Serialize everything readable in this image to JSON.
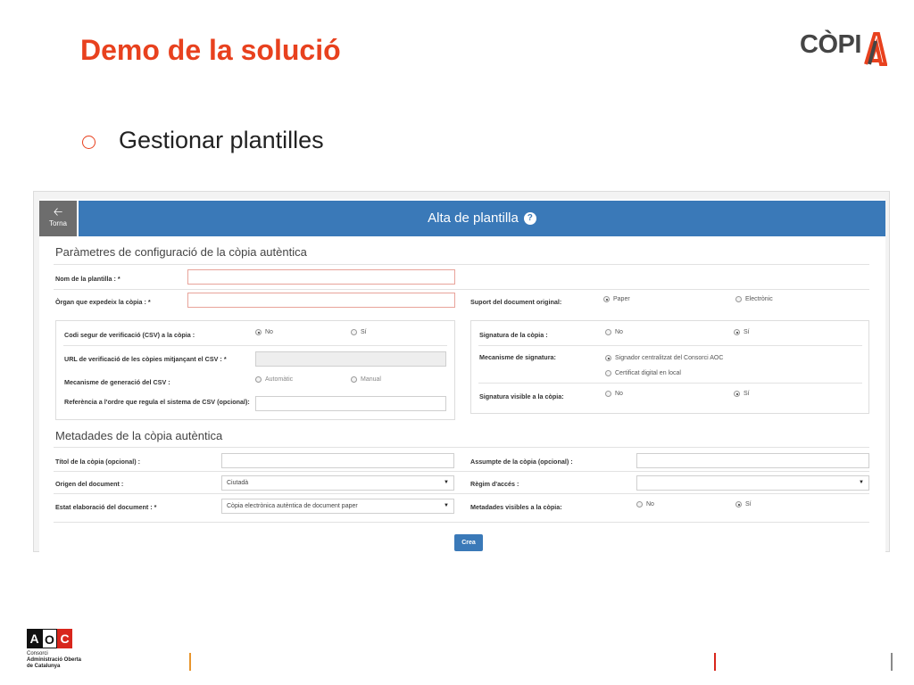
{
  "slide": {
    "title": "Demo de la solució",
    "bullet": "Gestionar plantilles",
    "logo_copia": "CÒPI",
    "aoc_logo": {
      "letters": [
        "A",
        "O",
        "C"
      ],
      "line1": "Consorci",
      "line2": "Administració Oberta",
      "line3": "de Catalunya"
    }
  },
  "app": {
    "back_label": "Torna",
    "header_title": "Alta de plantilla",
    "help_glyph": "?",
    "section1": {
      "title": "Paràmetres de configuració de la còpia autèntica",
      "nom_label": "Nom de la plantilla : *",
      "organ_label": "Òrgan que expedeix la còpia : *",
      "suport_label": "Suport del document original:",
      "suport_options": [
        "Paper",
        "Electrònic"
      ],
      "suport_selected": "Paper",
      "csv_panel": {
        "csv_label": "Codi segur de verificació (CSV) a la còpia :",
        "csv_options": [
          "No",
          "Sí"
        ],
        "url_label": "URL de verificació de les còpies mitjançant el CSV : *",
        "mecanisme_label": "Mecanisme de generació del CSV :",
        "mecanisme_options": [
          "Automàtic",
          "Manual"
        ],
        "referencia_label": "Referència a l'ordre que regula el sistema de CSV (opcional):"
      },
      "signatura_panel": {
        "signatura_label": "Signatura de la còpia :",
        "signatura_options": [
          "No",
          "Sí"
        ],
        "mecanisme_label": "Mecanisme de signatura:",
        "mecanisme_options": [
          "Signador centralitzat del Consorci AOC",
          "Certificat digital en local"
        ],
        "visible_label": "Signatura visible a la còpia:",
        "visible_options": [
          "No",
          "Sí"
        ]
      }
    },
    "section2": {
      "title": "Metadades de la còpia autèntica",
      "titol_label": "Títol de la còpia (opcional) :",
      "assumpte_label": "Assumpte de la còpia (opcional) :",
      "origen_label": "Origen del document :",
      "origen_value": "Ciutadà",
      "regim_label": "Règim d'accés :",
      "regim_value": "",
      "estat_label": "Estat elaboració del document : *",
      "estat_value": "Còpia electrònica autèntica de document paper",
      "metadades_visibles_label": "Metadades visibles a la còpia:",
      "metadades_options": [
        "No",
        "Sí"
      ]
    },
    "create_label": "Crea"
  },
  "colors": {
    "accent": "#e8411e",
    "header_blue": "#3a79b8",
    "back_gray": "#6d6d6d"
  }
}
